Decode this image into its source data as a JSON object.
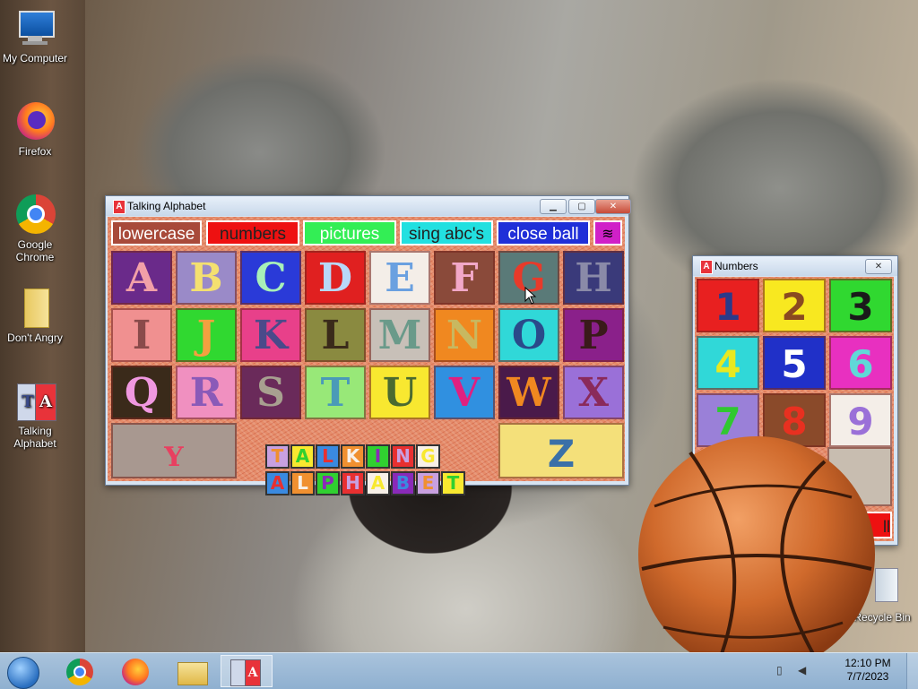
{
  "desktop": {
    "icons": [
      {
        "label": "My Computer",
        "icon": "computer-icon"
      },
      {
        "label": "Firefox",
        "icon": "firefox-icon"
      },
      {
        "label": "Google Chrome",
        "icon": "chrome-icon"
      },
      {
        "label": "Don't Angry",
        "icon": "folder-icon"
      },
      {
        "label": "Talking Alphabet",
        "icon": "talking-alphabet-icon"
      },
      {
        "label": "Recycle Bin",
        "icon": "recycle-bin-icon"
      }
    ]
  },
  "alphabet_window": {
    "title": "Talking Alphabet",
    "toolbar": {
      "lowercase": "lowercase",
      "numbers": "numbers",
      "pictures": "pictures",
      "sing": "sing abc's",
      "close_ball": "close ball",
      "wave_icon": "wave-icon"
    },
    "letters": [
      "A",
      "B",
      "C",
      "D",
      "E",
      "F",
      "G",
      "H",
      "I",
      "J",
      "K",
      "L",
      "M",
      "N",
      "O",
      "P",
      "Q",
      "R",
      "S",
      "T",
      "U",
      "V",
      "W",
      "X",
      "Y",
      "Z"
    ],
    "logo_line1": "TALKING",
    "logo_line2": "ALPHABET",
    "colors": {
      "lowercase_bg": "#a84a3a",
      "numbers_bg": "#ee1111",
      "pictures_bg": "#33ee55",
      "sing_bg": "#22e0e0",
      "close_ball_bg": "#1f2fd8",
      "wave_bg": "#d020c8"
    }
  },
  "numbers_window": {
    "title": "Numbers",
    "numbers": [
      "1",
      "2",
      "3",
      "4",
      "5",
      "6",
      "7",
      "8",
      "9"
    ],
    "partial_button": "ll"
  },
  "taskbar": {
    "time": "12:10 PM",
    "date": "7/7/2023",
    "items": [
      "start-orb-icon",
      "chrome-icon",
      "firefox-icon",
      "explorer-icon",
      "talking-alphabet-icon"
    ]
  }
}
